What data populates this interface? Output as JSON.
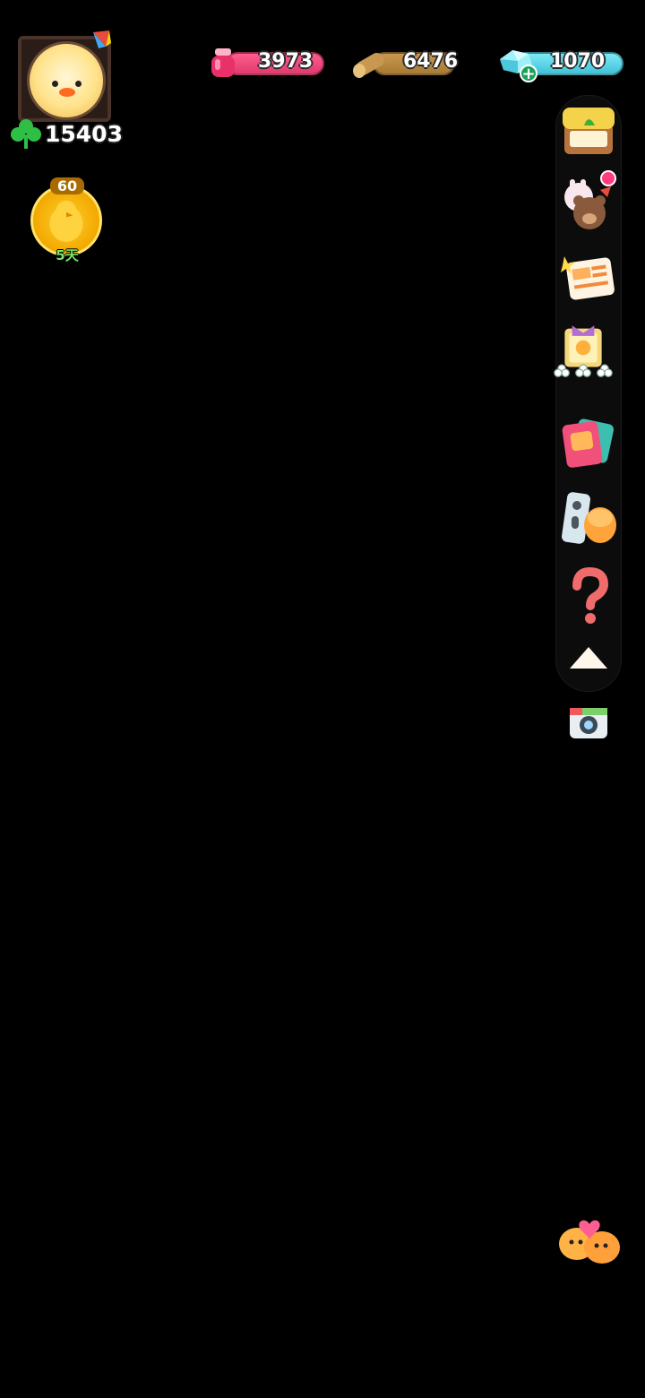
{
  "player": {
    "clover_score": "15403"
  },
  "event": {
    "level": "60",
    "days_left": "5天"
  },
  "resources": {
    "ink": "3973",
    "wood": "6476",
    "gems": "1070"
  },
  "side_menu": {
    "items": [
      {
        "icon": "shop-stall-icon"
      },
      {
        "icon": "friends-plush-icon",
        "has_notification": true
      },
      {
        "icon": "news-icon"
      },
      {
        "icon": "clover-board-icon"
      },
      {
        "icon": "album-icon"
      },
      {
        "icon": "remote-control-icon"
      },
      {
        "icon": "help-question-icon"
      }
    ],
    "collapse_icon": "chevron-up-icon"
  },
  "colors": {
    "ink_bar": "#e03b6e",
    "wood_bar": "#a87a33",
    "gem_bar": "#3fc2d8",
    "clover": "#2fbf45",
    "badge_gold": "#f2a800"
  }
}
